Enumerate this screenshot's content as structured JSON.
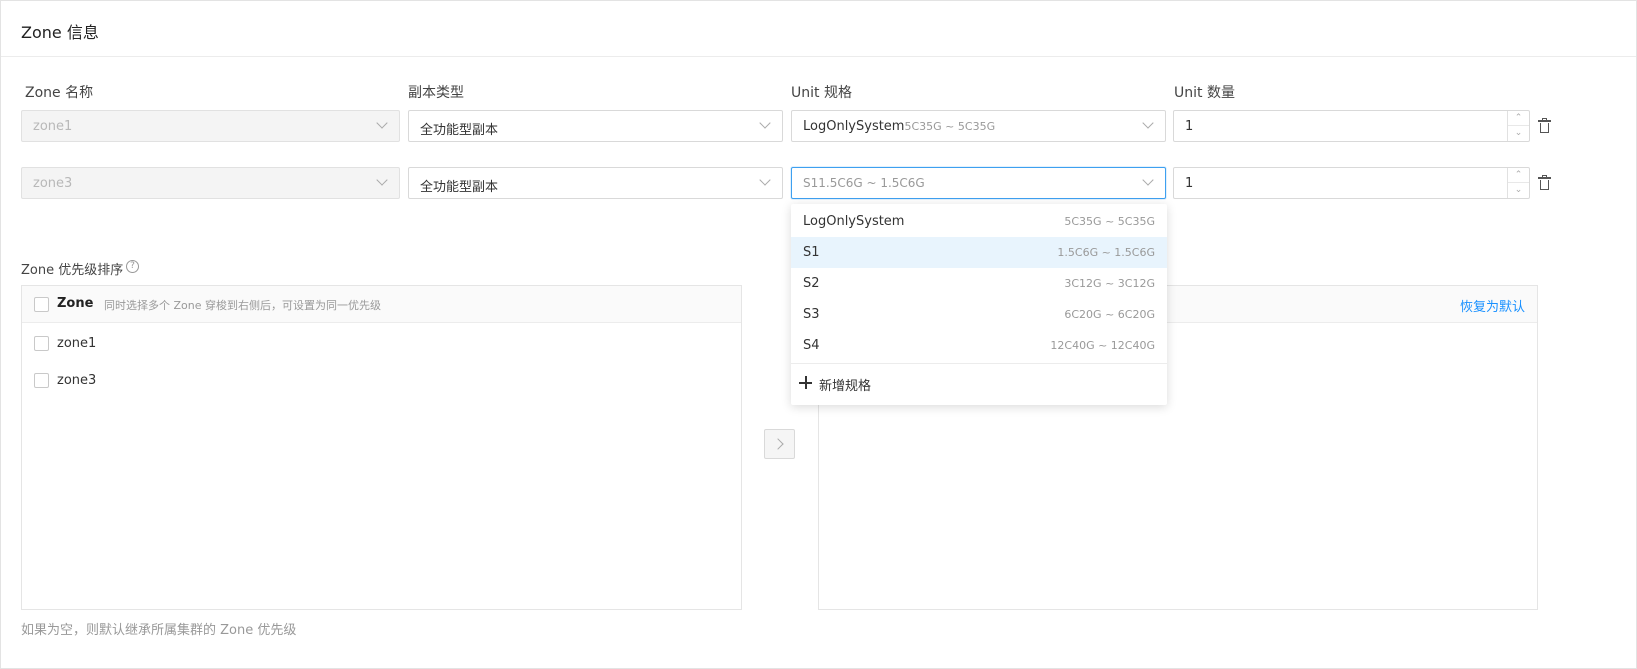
{
  "header": {
    "title": "Zone 信息"
  },
  "columns": {
    "zone_name": "Zone 名称",
    "replica_type": "副本类型",
    "unit_spec": "Unit 规格",
    "unit_count": "Unit 数量"
  },
  "rows": [
    {
      "zone": "zone1",
      "replica": "全功能型副本",
      "spec_name": "LogOnlySystem",
      "spec_detail": "5C35G ~ 5C35G",
      "count": "1"
    },
    {
      "zone": "zone3",
      "replica": "全功能型副本",
      "spec_placeholder": "S11.5C6G ~ 1.5C6G",
      "count": "1"
    }
  ],
  "dropdown": {
    "options": [
      {
        "name": "LogOnlySystem",
        "spec": "5C35G ~ 5C35G",
        "selected": false
      },
      {
        "name": "S1",
        "spec": "1.5C6G ~ 1.5C6G",
        "selected": true
      },
      {
        "name": "S2",
        "spec": "3C12G ~ 3C12G",
        "selected": false
      },
      {
        "name": "S3",
        "spec": "6C20G ~ 6C20G",
        "selected": false
      },
      {
        "name": "S4",
        "spec": "12C40G ~ 12C40G",
        "selected": false
      }
    ],
    "add_label": "新增规格"
  },
  "priority": {
    "label": "Zone 优先级排序",
    "help_icon": "?",
    "left": {
      "header": "Zone",
      "hint": "同时选择多个 Zone 穿梭到右侧后，可设置为同一优先级",
      "items": [
        "zone1",
        "zone3"
      ]
    },
    "transfer_icon": "chevron-right-icon",
    "right": {
      "reset_label": "恢复为默认"
    },
    "footer_hint": "如果为空，则默认继承所属集群的 Zone 优先级"
  },
  "colors": {
    "accent": "#1890ff",
    "focus_border": "#3ea0f0",
    "selected_bg": "#e8f4fd"
  }
}
